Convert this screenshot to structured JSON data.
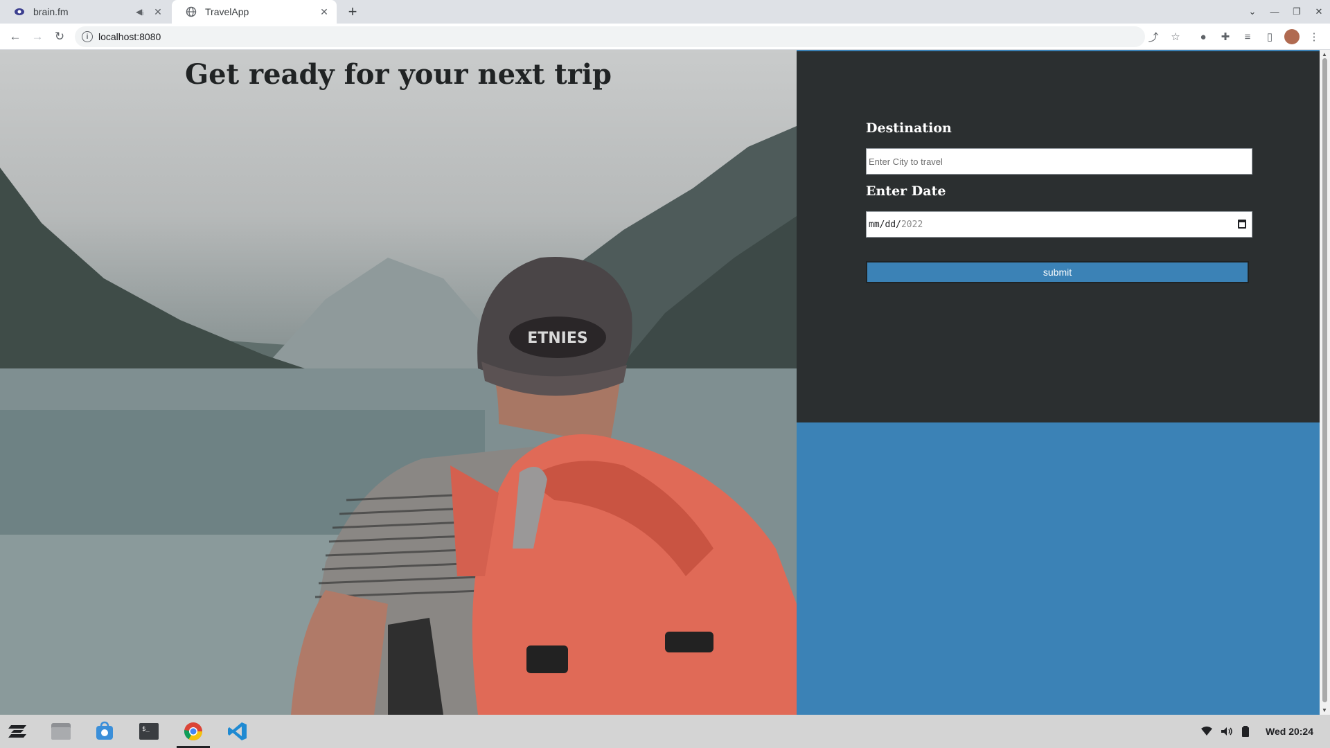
{
  "browser": {
    "tabs": [
      {
        "title": "brain.fm",
        "active": false,
        "icon": "brainfm-icon"
      },
      {
        "title": "TravelApp",
        "active": true,
        "icon": "globe-icon"
      }
    ],
    "url": "localhost:8080"
  },
  "page": {
    "heading": "Get ready for your next trip",
    "form": {
      "destination_label": "Destination",
      "destination_placeholder": "Enter City to travel",
      "date_label": "Enter Date",
      "date_mask": "mm/dd/",
      "date_year": "2022",
      "submit_label": "submit"
    },
    "colors": {
      "form_bg": "#2b2f30",
      "accent": "#3b82b6"
    }
  },
  "taskbar": {
    "apps": [
      "zorin-menu-icon",
      "files-icon",
      "software-store-icon",
      "terminal-icon",
      "chrome-icon",
      "vscode-icon"
    ],
    "clock": "Wed 20:24"
  }
}
